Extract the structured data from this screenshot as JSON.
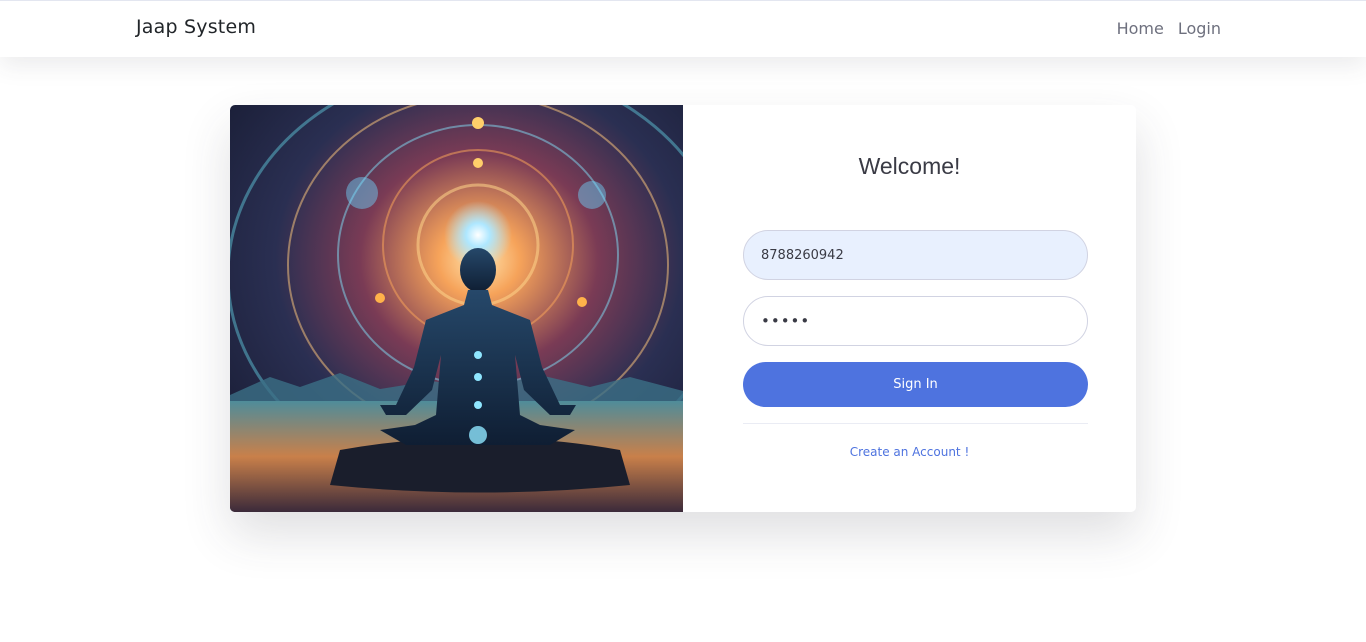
{
  "navbar": {
    "brand": "Jaap System",
    "links": [
      {
        "label": "Home"
      },
      {
        "label": "Login"
      }
    ]
  },
  "login": {
    "welcome": "Welcome!",
    "phone_value": "8788260942",
    "password_value": "•••••",
    "sign_in_label": "Sign In",
    "create_account_label": "Create an Account !"
  },
  "colors": {
    "primary": "#4e73df",
    "autofill_bg": "#e8f0fe"
  }
}
